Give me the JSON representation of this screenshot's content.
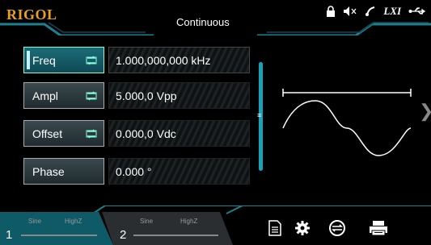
{
  "header": {
    "logo": "RIGOL",
    "mode": "Continuous",
    "status_icons": [
      "lock-icon",
      "mute-icon",
      "remote-icon",
      "lxi-icon",
      "usb-icon"
    ],
    "lxi_label": "LXI"
  },
  "params": [
    {
      "label": "Freq",
      "value": "1.000,000,000 kHz",
      "has_toggle": true,
      "active": true
    },
    {
      "label": "Ampl",
      "value": "5.000,0 Vpp",
      "has_toggle": true,
      "active": false
    },
    {
      "label": "Offset",
      "value": "0.000,0 Vdc",
      "has_toggle": true,
      "active": false
    },
    {
      "label": "Phase",
      "value": "0.000 °",
      "has_toggle": false,
      "active": false
    }
  ],
  "channels": [
    {
      "number": "1",
      "waveform": "Sine",
      "impedance": "HighZ",
      "active": true
    },
    {
      "number": "2",
      "waveform": "Sine",
      "impedance": "HighZ",
      "active": false
    }
  ],
  "toolbar": [
    "file-icon",
    "settings-gear-icon",
    "counter-icon",
    "print-icon"
  ],
  "colors": {
    "logo": "#e8a020",
    "accent": "#1aa2b8",
    "active_key": "#1c6b78"
  }
}
